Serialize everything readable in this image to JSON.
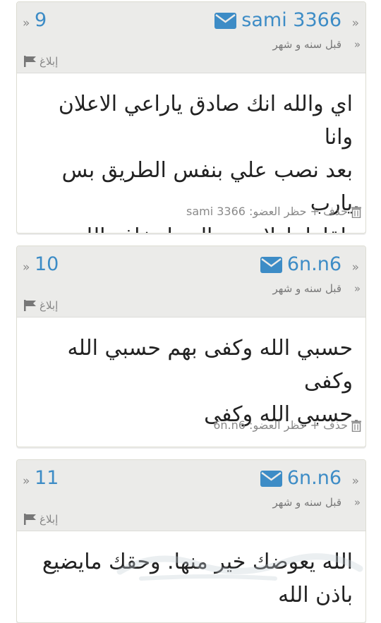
{
  "comments": [
    {
      "number": "9",
      "username": "sami 3366",
      "time": "قبل سنه و شهر",
      "report": "إبلاغ",
      "text_lines": [
        "اي والله انك صادق ياراعي الاعلان وانا",
        "بعد نصب علي بنفس الطريق بس يارب",
        "يلقاها باولاده رجال ما يخاف الله"
      ],
      "footer": "sami 3366 :حذف + حظر العضو"
    },
    {
      "number": "10",
      "username": "6n.n6",
      "time": "قبل سنه و شهر",
      "report": "إبلاغ",
      "text_lines": [
        "حسبي الله وكفى بهم حسبي الله وكفى",
        "حسبي الله وكفى"
      ],
      "footer": "6n.n6 :حذف + حظر العضو"
    },
    {
      "number": "11",
      "username": "6n.n6",
      "time": "قبل سنه و شهر",
      "report": "إبلاغ",
      "text_lines": [
        "الله يعوضك خير منها. وحقك مايضيع",
        "باذن الله"
      ]
    }
  ],
  "icons": {
    "mail": "envelope-icon",
    "flag": "flag-icon",
    "trash": "trash-icon",
    "guillemet": "»"
  },
  "colors": {
    "accent": "#3d8cc6",
    "header_bg": "#ebebe9",
    "text": "#222222",
    "muted": "#888888"
  }
}
